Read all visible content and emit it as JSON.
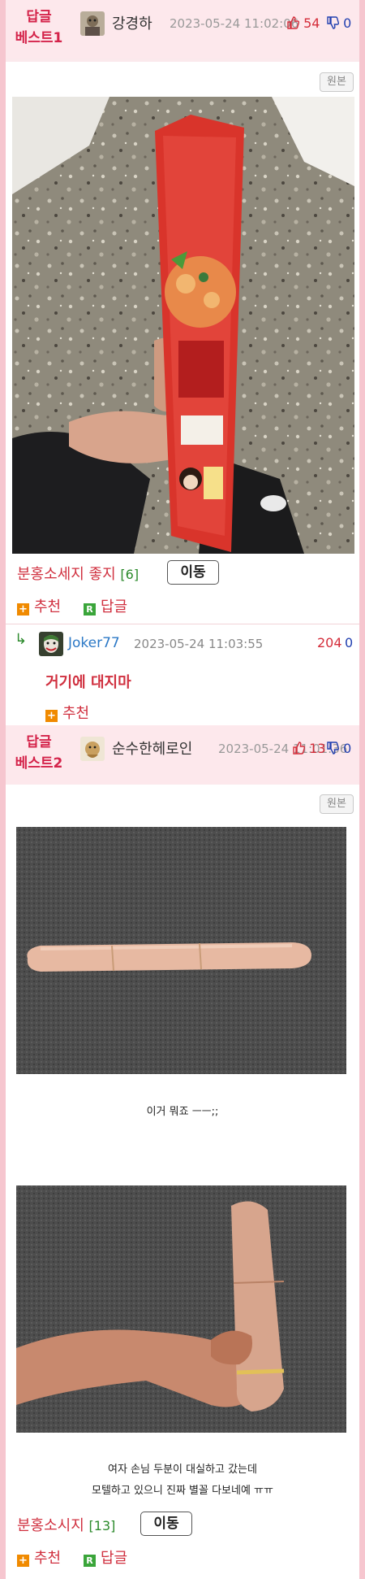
{
  "best1": {
    "label_line1": "답글",
    "label_line2": "베스트1",
    "username": "강경하",
    "date": "2023-05-24 11:02:06",
    "likes": "54",
    "dislikes": "0",
    "original_button": "원본",
    "comment_title": "분홍소세지 좋지",
    "comment_count": "[6]",
    "move_button": "이동",
    "recommend_label": "추천",
    "reply_label": "답글"
  },
  "reply1": {
    "username": "Joker77",
    "date": "2023-05-24 11:03:55",
    "likes": "204",
    "dislikes": "0",
    "text": "거기에 대지마",
    "recommend_label": "추천"
  },
  "best2": {
    "label_line1": "답글",
    "label_line2": "베스트2",
    "username": "순수한헤로인",
    "date": "2023-05-24 11:01:36",
    "likes": "13",
    "dislikes": "0",
    "original_button": "원본",
    "caption1": "이거 뭐죠 ㅡㅡ;;",
    "caption2_line1": "여자 손님 두분이 대실하고 갔는데",
    "caption2_line2": "모텔하고 있으니 진짜 별꼴 다보네예 ㅠㅠ",
    "comment_title": "분홍소시지",
    "comment_count": "[13]",
    "move_button": "이동",
    "recommend_label": "추천",
    "reply_label": "답글"
  },
  "colors": {
    "accent_red": "#d0303f",
    "best_header_bg": "#fde8ec",
    "frame_border": "#f6c6cf",
    "like_red": "#d42d3a",
    "dislike_blue": "#2240b0",
    "link_blue": "#2b78c6",
    "count_green": "#2b8a2b"
  },
  "icons": {
    "like": "thumbs-up-icon",
    "dislike": "thumbs-down-icon",
    "recommend": "plus-icon",
    "reply": "reply-r-icon",
    "reply_arrow": "reply-arrow-icon"
  }
}
